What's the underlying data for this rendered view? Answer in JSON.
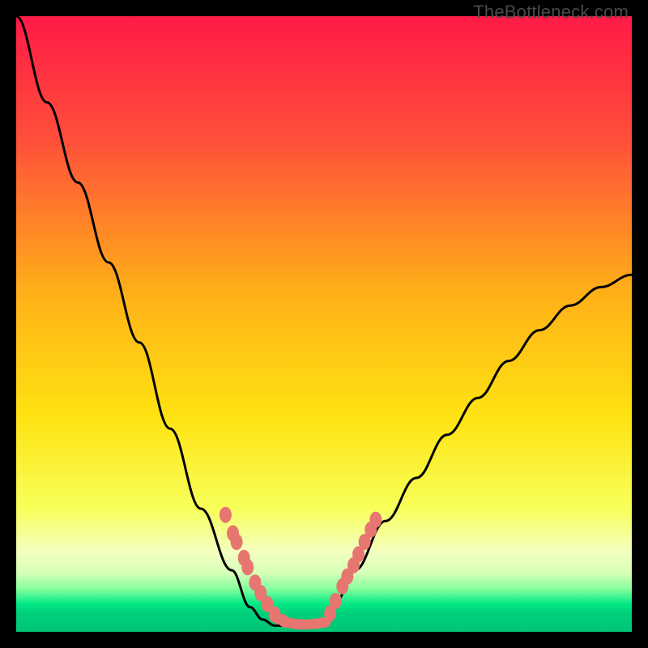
{
  "watermark": {
    "text": "TheBottleneck.com"
  },
  "colors": {
    "background": "#000000",
    "gradient_stops": [
      {
        "pos": 0.0,
        "color": "#ff1a46"
      },
      {
        "pos": 0.2,
        "color": "#ff4f3a"
      },
      {
        "pos": 0.45,
        "color": "#ffb018"
      },
      {
        "pos": 0.65,
        "color": "#ffe312"
      },
      {
        "pos": 0.8,
        "color": "#f7ff5a"
      },
      {
        "pos": 0.87,
        "color": "#f4ffc0"
      },
      {
        "pos": 0.905,
        "color": "#d6ffb8"
      },
      {
        "pos": 0.93,
        "color": "#86ff9e"
      },
      {
        "pos": 0.955,
        "color": "#00e884"
      },
      {
        "pos": 0.97,
        "color": "#00cf7a"
      },
      {
        "pos": 1.0,
        "color": "#00c577"
      }
    ],
    "curve": "#000000",
    "dot": "#e77570"
  },
  "chart_data": {
    "type": "line",
    "title": "",
    "xlabel": "",
    "ylabel": "",
    "x": [
      0.0,
      0.05,
      0.1,
      0.15,
      0.2,
      0.25,
      0.3,
      0.35,
      0.38,
      0.4,
      0.42,
      0.44,
      0.46,
      0.48,
      0.5,
      0.52,
      0.55,
      0.6,
      0.65,
      0.7,
      0.75,
      0.8,
      0.85,
      0.9,
      0.95,
      1.0
    ],
    "y": [
      1.0,
      0.86,
      0.73,
      0.6,
      0.47,
      0.33,
      0.2,
      0.1,
      0.04,
      0.02,
      0.01,
      0.01,
      0.01,
      0.01,
      0.02,
      0.05,
      0.1,
      0.18,
      0.25,
      0.32,
      0.38,
      0.44,
      0.49,
      0.53,
      0.56,
      0.58
    ],
    "xlim": [
      0,
      1
    ],
    "ylim": [
      0,
      1
    ],
    "markers": {
      "left_cluster": [
        [
          0.34,
          0.19
        ],
        [
          0.352,
          0.16
        ],
        [
          0.358,
          0.146
        ],
        [
          0.37,
          0.12
        ],
        [
          0.376,
          0.105
        ],
        [
          0.388,
          0.08
        ],
        [
          0.397,
          0.063
        ],
        [
          0.408,
          0.045
        ],
        [
          0.42,
          0.028
        ]
      ],
      "bottom_cluster": [
        [
          0.43,
          0.02
        ],
        [
          0.44,
          0.015
        ],
        [
          0.452,
          0.013
        ],
        [
          0.462,
          0.012
        ],
        [
          0.474,
          0.012
        ],
        [
          0.486,
          0.013
        ],
        [
          0.498,
          0.015
        ]
      ],
      "right_cluster": [
        [
          0.51,
          0.03
        ],
        [
          0.519,
          0.05
        ],
        [
          0.53,
          0.074
        ],
        [
          0.538,
          0.09
        ],
        [
          0.548,
          0.108
        ],
        [
          0.556,
          0.126
        ],
        [
          0.566,
          0.146
        ],
        [
          0.576,
          0.166
        ],
        [
          0.584,
          0.182
        ]
      ]
    }
  }
}
